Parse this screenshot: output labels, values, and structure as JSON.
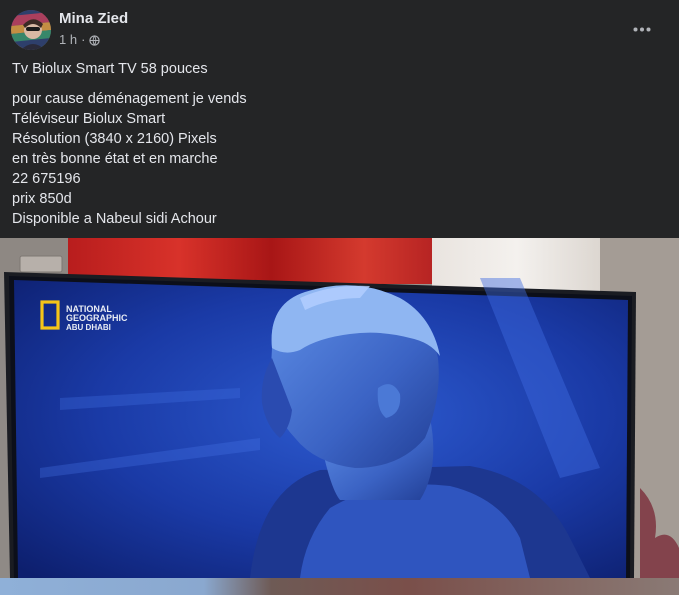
{
  "post": {
    "author": "Mina Zied",
    "time": "1 h",
    "separator": "·",
    "privacy_icon": "globe-icon",
    "more_icon": "more-options-icon",
    "title_line": "Tv Biolux Smart TV 58 pouces",
    "body_lines": [
      "pour cause déménagement je vends",
      "Téléviseur Biolux Smart",
      "Résolution (3840 x 2160) Pixels",
      "en très bonne état et en marche",
      "22 675196",
      "prix 850d",
      "Disponible a Nabeul sidi Achour"
    ]
  },
  "photo": {
    "logo_lines": [
      "NATIONAL",
      "GEOGRAPHIC",
      "ABU DHABI"
    ]
  },
  "colors": {
    "background": "#242526",
    "text_primary": "#e4e6eb",
    "text_secondary": "#b0b3b8",
    "tv_screen": "#1e3fa0",
    "logo_yellow": "#f5c518"
  }
}
